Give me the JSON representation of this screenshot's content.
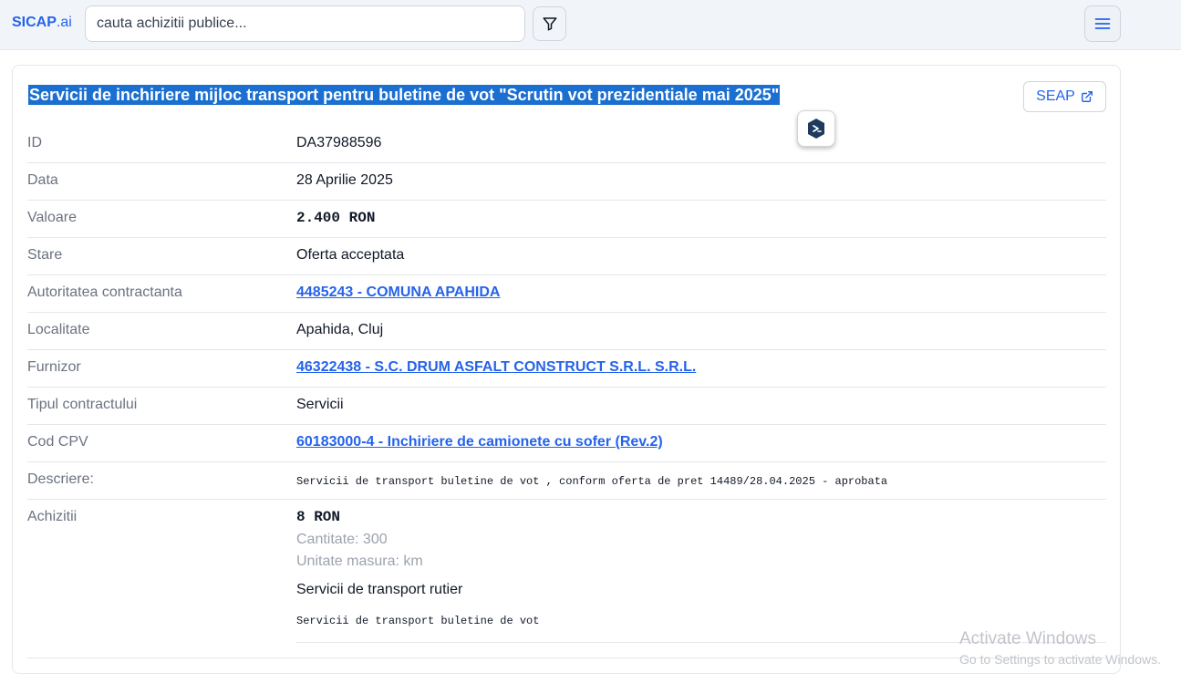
{
  "header": {
    "logo_main": "SICAP",
    "logo_suffix": ".ai",
    "search_placeholder": "cauta achizitii publice..."
  },
  "title": "Servicii de inchiriere mijloc transport pentru buletine de vot \"Scrutin vot prezidentiale mai 2025\"",
  "seap_label": "SEAP",
  "fields": [
    {
      "label": "ID",
      "value": "DA37988596"
    },
    {
      "label": "Data",
      "value": "28 Aprilie 2025"
    },
    {
      "label": "Valoare",
      "value": "2.400 RON"
    },
    {
      "label": "Stare",
      "value": "Oferta acceptata"
    },
    {
      "label": "Autoritatea contractanta",
      "value": "4485243 - COMUNA APAHIDA"
    },
    {
      "label": "Localitate",
      "value": "Apahida, Cluj"
    },
    {
      "label": "Furnizor",
      "value": "46322438 - S.C. DRUM ASFALT CONSTRUCT S.R.L. S.R.L."
    },
    {
      "label": "Tipul contractului",
      "value": "Servicii"
    },
    {
      "label": "Cod CPV",
      "value": "60183000-4 - Inchiriere de camionete cu sofer (Rev.2)"
    },
    {
      "label": "Descriere:",
      "value": "Servicii de transport buletine de vot , conform oferta de pret 14489/28.04.2025 - aprobata"
    }
  ],
  "achizitii": {
    "label": "Achizitii",
    "price": "8 RON",
    "quantity": "Cantitate: 300",
    "unit": "Unitate masura: km",
    "service": "Servicii de transport rutier",
    "description": "Servicii de transport buletine de vot"
  },
  "watermark": {
    "line1": "Activate Windows",
    "line2": "Go to Settings to activate Windows."
  },
  "colors": {
    "accent": "#2563eb",
    "title_highlight": "#1a6fd0"
  }
}
